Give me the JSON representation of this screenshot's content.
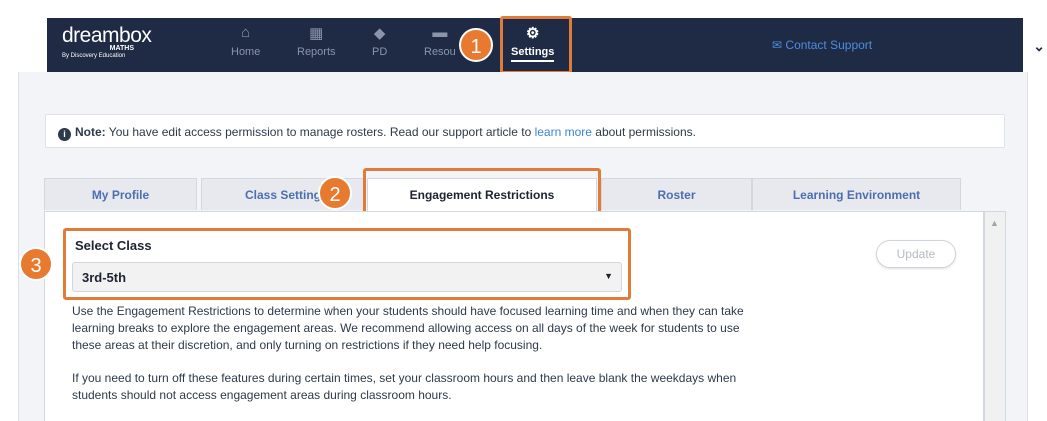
{
  "brand": {
    "name": "dreambox",
    "product": "MATHS",
    "by": "By Discovery Education"
  },
  "nav": {
    "items": [
      {
        "label": "Home",
        "icon": "home-icon",
        "glyph": "⌂"
      },
      {
        "label": "Reports",
        "icon": "grid-icon",
        "glyph": "▦"
      },
      {
        "label": "PD",
        "icon": "graduation-cap-icon",
        "glyph": "◆"
      },
      {
        "label": "Resou",
        "icon": "briefcase-icon",
        "glyph": "▬"
      },
      {
        "label": "Settings",
        "icon": "gear-icon",
        "glyph": "⚙"
      }
    ],
    "contact": "Contact Support",
    "contact_icon": "mail-icon"
  },
  "callouts": [
    "1",
    "2",
    "3"
  ],
  "note": {
    "bold": "Note:",
    "text_before": " You have edit access permission to manage rosters. Read our support article to ",
    "link": "learn more",
    "text_after": " about permissions."
  },
  "tabs": [
    "My Profile",
    "Class Setting",
    "Engagement Restrictions",
    "Roster",
    "Learning Environment"
  ],
  "select": {
    "label": "Select Class",
    "value": "3rd-5th"
  },
  "update_label": "Update",
  "paragraphs": [
    "Use the Engagement Restrictions to determine when your students should have focused learning time and when they can take learning breaks to explore the engagement areas. We recommend allowing access on all days of the week for students to use these areas at their discretion, and only turning on restrictions if they need help focusing.",
    "If you need to turn off these features during certain times, set your classroom hours and then leave blank the weekdays when students should not access engagement areas during classroom hours."
  ],
  "colors": {
    "nav_bg": "#1f2a44",
    "callout": "#e87a30",
    "link": "#3a83d8"
  }
}
